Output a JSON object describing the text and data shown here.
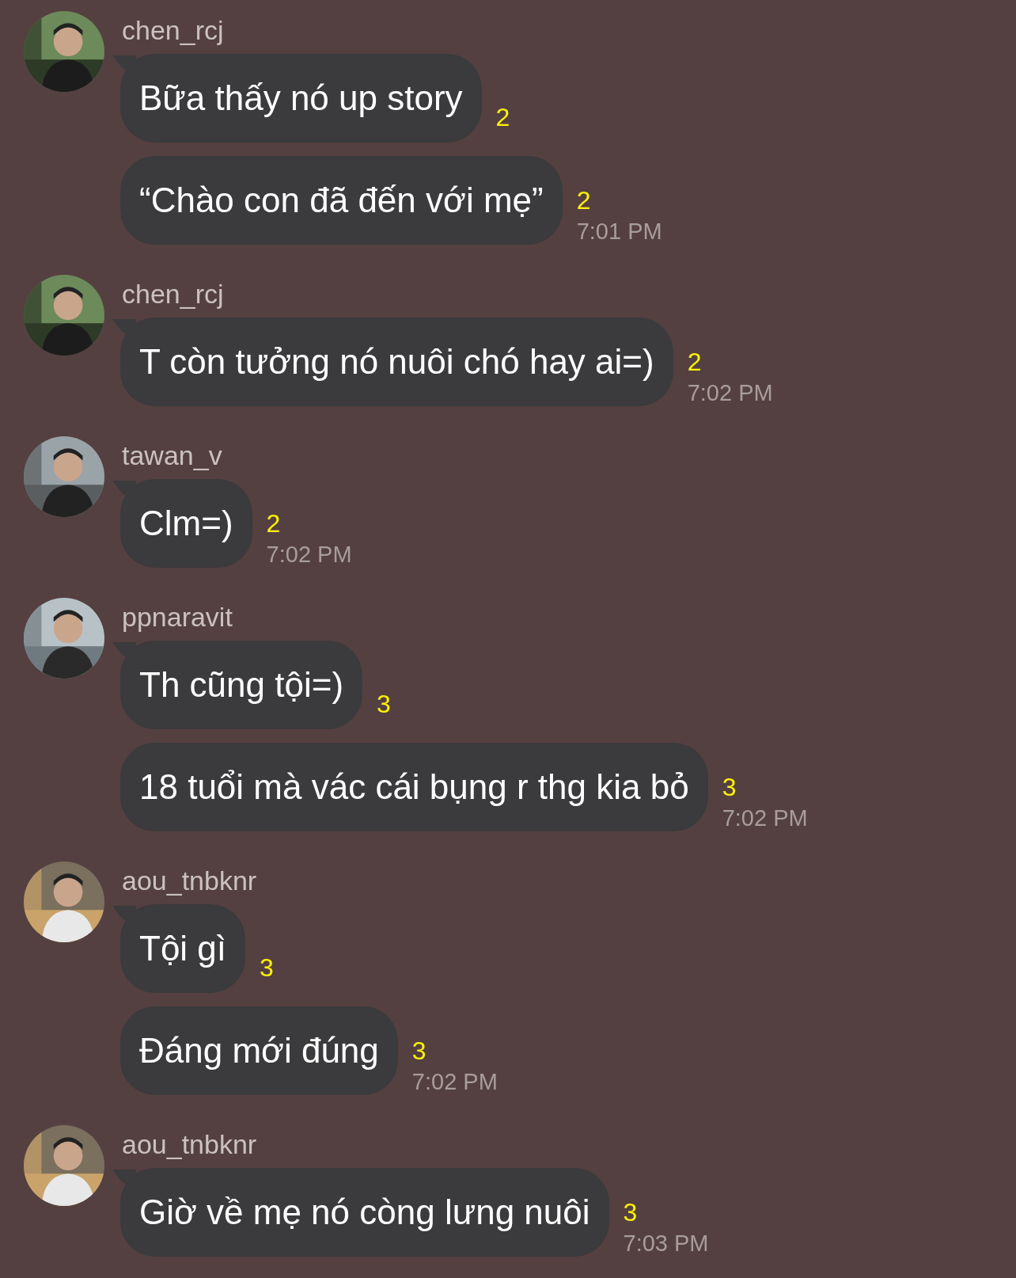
{
  "groups": [
    {
      "username": "chen_rcj",
      "messages": [
        {
          "text": "Bữa thấy nó up story",
          "read": "2"
        },
        {
          "text": "“Chào con đã đến với mẹ”",
          "read": "2",
          "time": "7:01 PM"
        }
      ]
    },
    {
      "username": "chen_rcj",
      "messages": [
        {
          "text": "T còn tưởng nó nuôi chó hay ai=)",
          "read": "2",
          "time": "7:02 PM"
        }
      ]
    },
    {
      "username": "tawan_v",
      "messages": [
        {
          "text": "Clm=)",
          "read": "2",
          "time": "7:02 PM"
        }
      ]
    },
    {
      "username": "ppnaravit",
      "messages": [
        {
          "text": "Th cũng tội=)",
          "read": "3"
        },
        {
          "text": "18 tuổi mà vác cái bụng r thg kia bỏ",
          "read": "3",
          "time": "7:02 PM"
        }
      ]
    },
    {
      "username": "aou_tnbknr",
      "messages": [
        {
          "text": "Tội gì",
          "read": "3"
        },
        {
          "text": "Đáng mới đúng",
          "read": "3",
          "time": "7:02 PM"
        }
      ]
    },
    {
      "username": "aou_tnbknr",
      "messages": [
        {
          "text": "Giờ về mẹ nó còng lưng nuôi",
          "read": "3",
          "time": "7:03 PM"
        }
      ]
    }
  ]
}
